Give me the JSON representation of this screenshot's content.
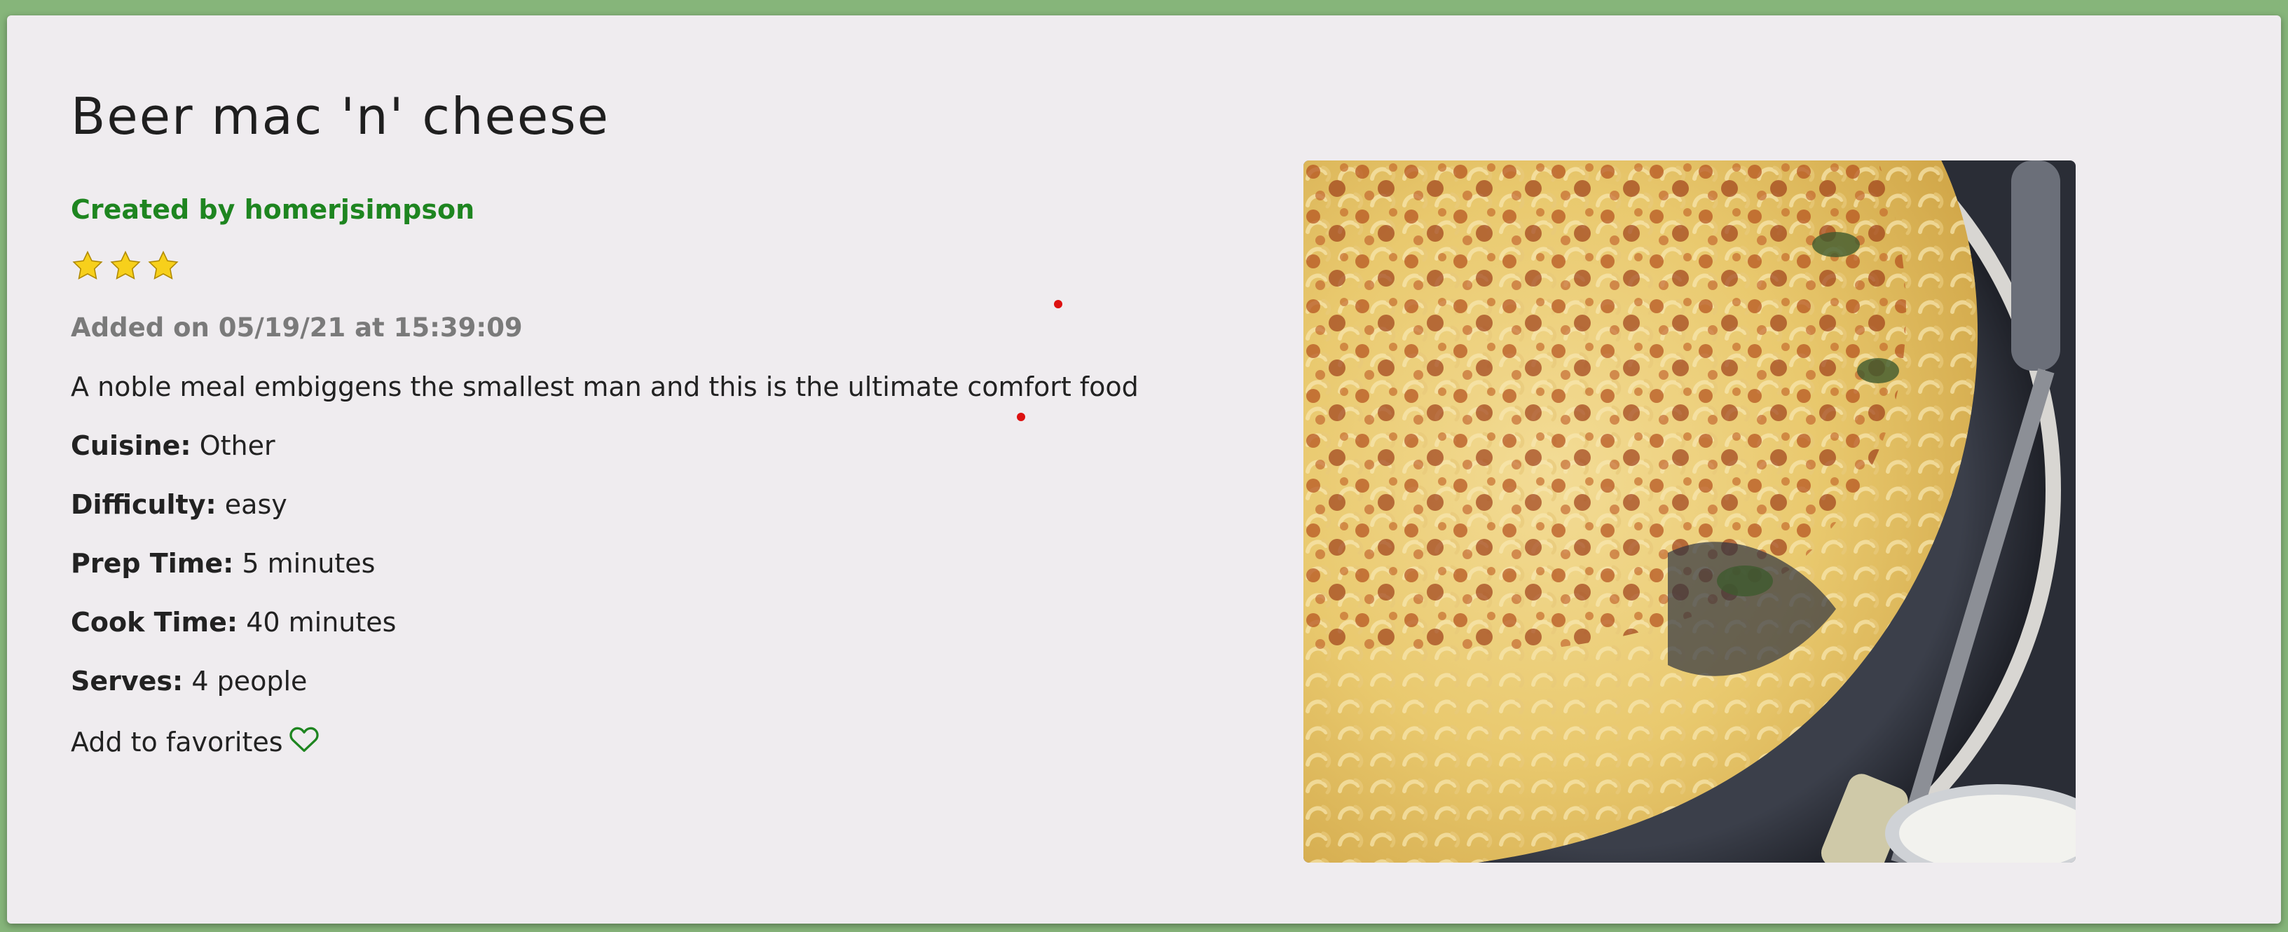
{
  "recipe": {
    "title": "Beer mac 'n' cheese",
    "created_by": "Created by homerjsimpson",
    "rating": 3,
    "added": "Added on 05/19/21 at 15:39:09",
    "description": "A noble meal embiggens the smallest man and this is the ultimate comfort food",
    "details": [
      {
        "label": "Cuisine:",
        "value": "Other"
      },
      {
        "label": "Difficulty:",
        "value": "easy"
      },
      {
        "label": "Prep Time:",
        "value": "5 minutes"
      },
      {
        "label": "Cook Time:",
        "value": "40 minutes"
      },
      {
        "label": "Serves:",
        "value": "4 people"
      }
    ],
    "favorites_label": "Add to favorites",
    "favorites_icon": "heart-outline-icon",
    "star_icon": "star-icon"
  },
  "colors": {
    "page_background": "#86b57a",
    "card_background": "#efecef",
    "author": "#1e8520",
    "muted": "#7a7a7a",
    "heart": "#1e8520",
    "star": "#f7d01b"
  }
}
